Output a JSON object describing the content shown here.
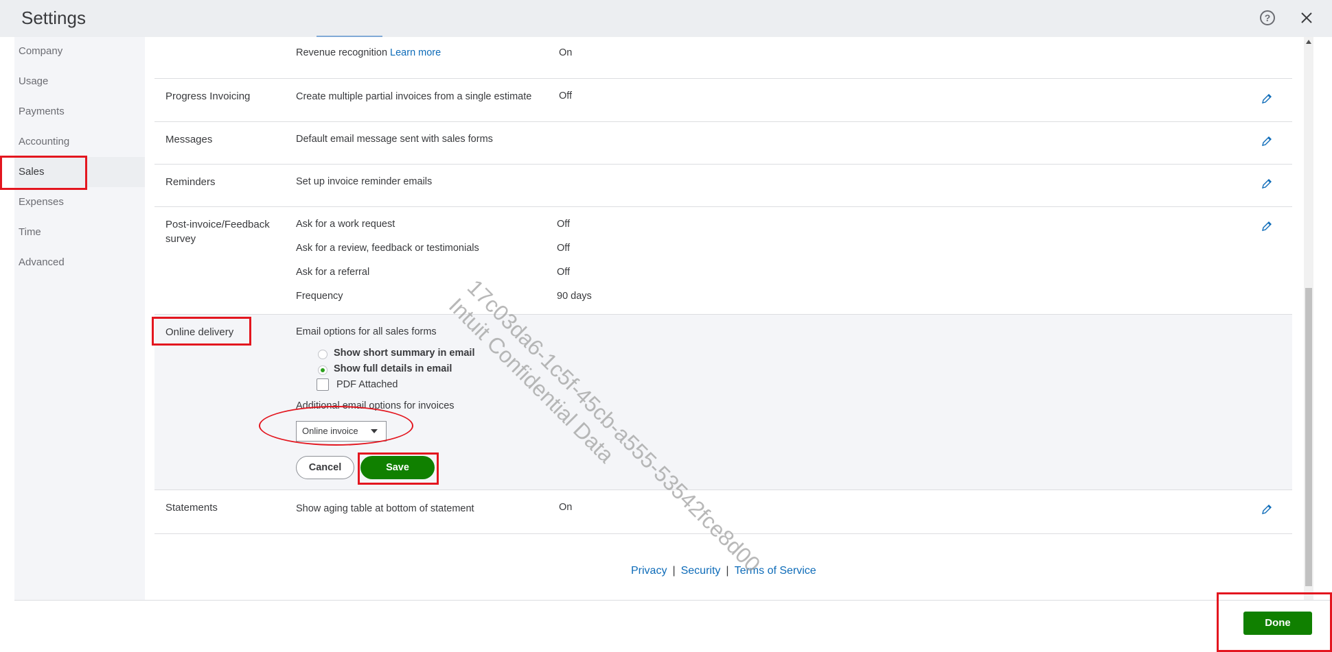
{
  "window": {
    "title": "Settings"
  },
  "sidebar": {
    "items": [
      {
        "label": "Company"
      },
      {
        "label": "Usage"
      },
      {
        "label": "Payments"
      },
      {
        "label": "Accounting"
      },
      {
        "label": "Sales",
        "active": true
      },
      {
        "label": "Expenses"
      },
      {
        "label": "Time"
      },
      {
        "label": "Advanced"
      }
    ]
  },
  "sections": {
    "revenue": {
      "desc": "Revenue recognition",
      "link": "Learn more",
      "value": "On"
    },
    "progress_invoicing": {
      "title": "Progress Invoicing",
      "desc": "Create multiple partial invoices from a single estimate",
      "value": "Off"
    },
    "messages": {
      "title": "Messages",
      "desc": "Default email message sent with sales forms"
    },
    "reminders": {
      "title": "Reminders",
      "desc": "Set up invoice reminder emails"
    },
    "post_invoice": {
      "title_line1": "Post-invoice/Feedback",
      "title_line2": "survey",
      "rows": [
        {
          "desc": "Ask for a work request",
          "value": "Off"
        },
        {
          "desc": "Ask for a review, feedback or testimonials",
          "value": "Off"
        },
        {
          "desc": "Ask for a referral",
          "value": "Off"
        },
        {
          "desc": "Frequency",
          "value": "90 days"
        }
      ]
    },
    "online_delivery": {
      "title": "Online delivery",
      "email_options_label": "Email options for all sales forms",
      "radio_short": "Show short summary in email",
      "radio_full": "Show full details in email",
      "selected_radio": "full",
      "pdf_attached": "PDF Attached",
      "pdf_checked": false,
      "additional_label": "Additional email options for invoices",
      "select_value": "Online invoice",
      "cancel": "Cancel",
      "save": "Save"
    },
    "statements": {
      "title": "Statements",
      "desc": "Show aging table at bottom of statement",
      "value": "On"
    }
  },
  "footer": {
    "privacy": "Privacy",
    "security": "Security",
    "terms": "Terms of Service",
    "separator": "|"
  },
  "done_button": "Done",
  "watermark": {
    "line1": "17c03da6-1c5f-45cb-a555-53542fce8d00",
    "line2": "Intuit Confidential Data"
  },
  "colors": {
    "accent_green": "#108000",
    "link_blue": "#0d6bb8",
    "highlight_red": "#e3161f"
  },
  "icons": [
    "help-icon",
    "close-icon",
    "pencil-icon",
    "caret-down-icon"
  ]
}
